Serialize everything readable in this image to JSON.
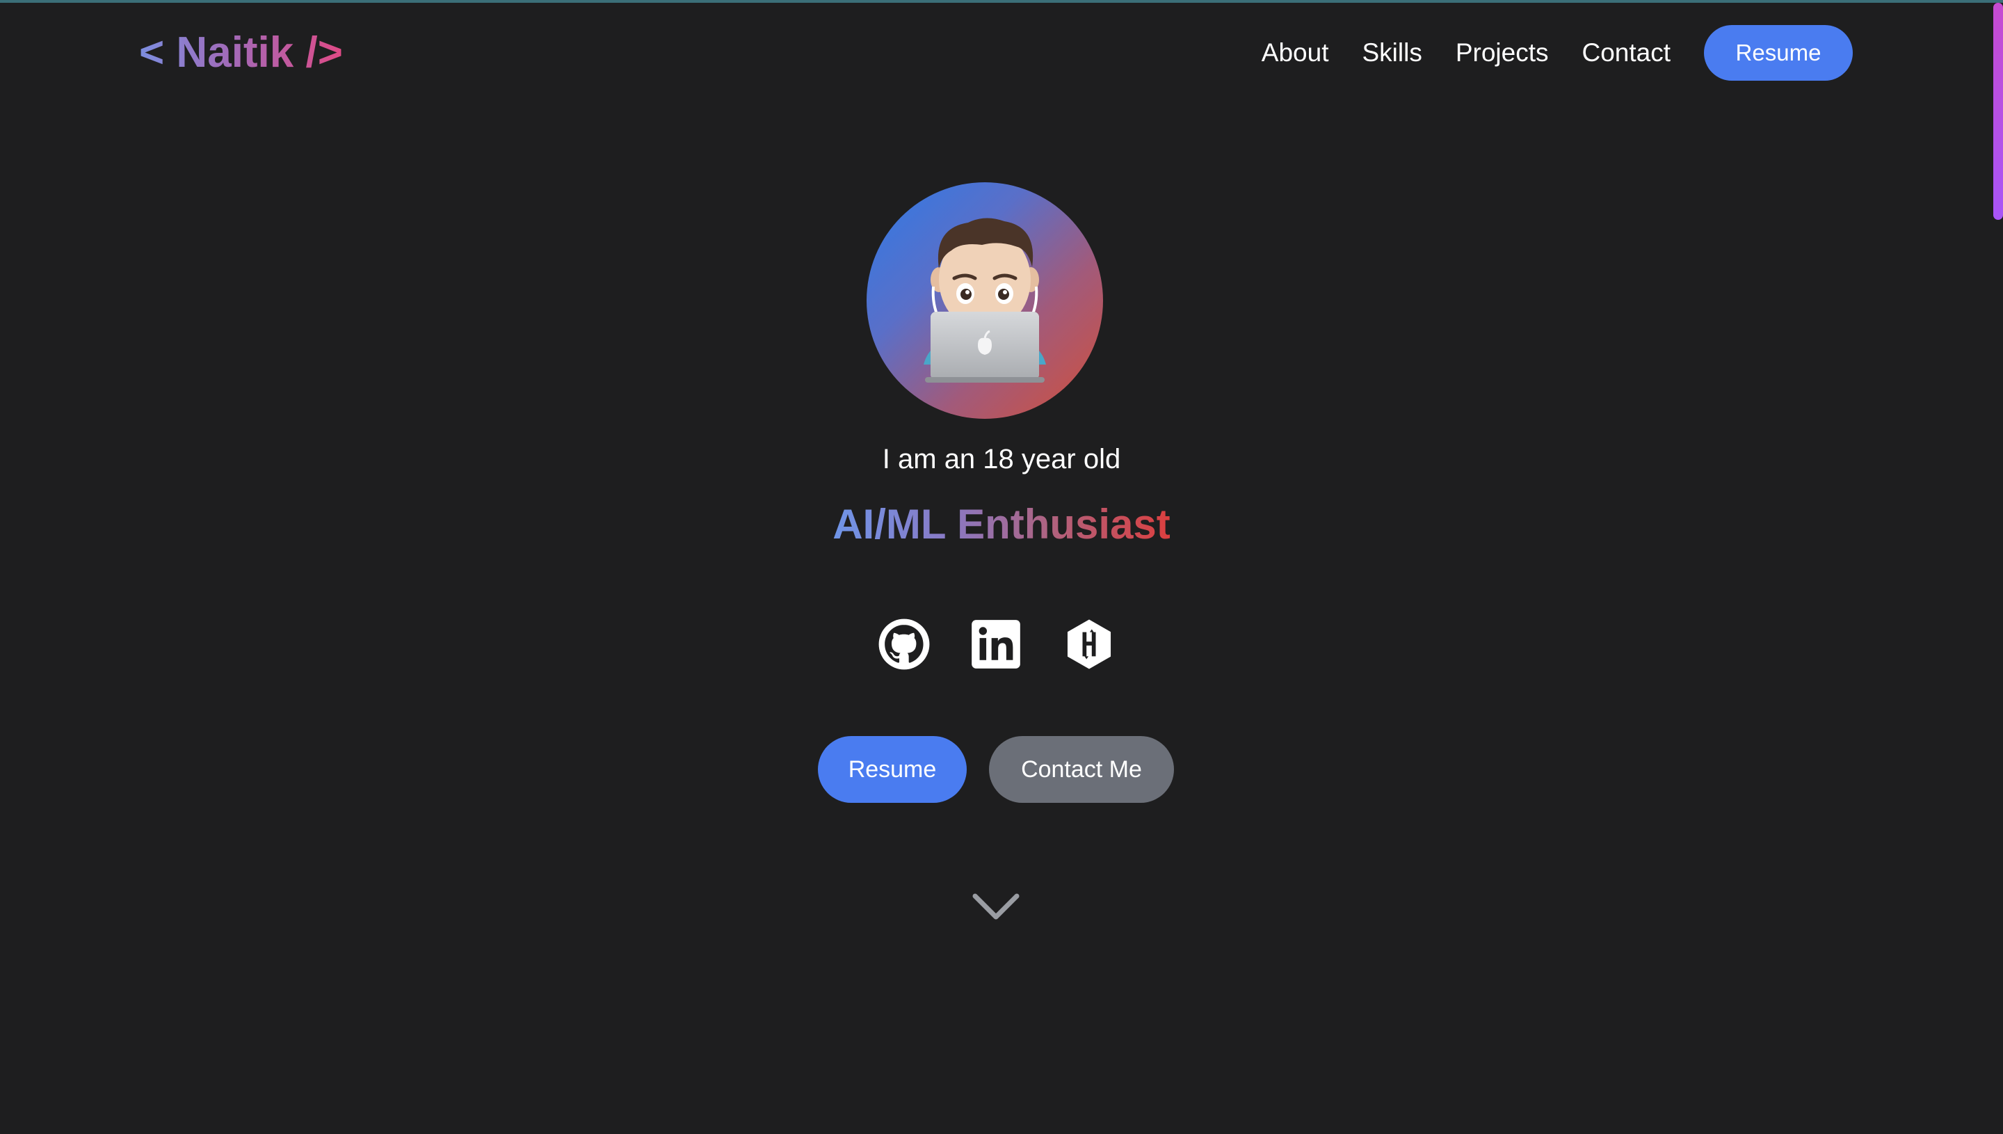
{
  "header": {
    "logo": "< Naitik />",
    "nav": {
      "about": "About",
      "skills": "Skills",
      "projects": "Projects",
      "contact": "Contact",
      "resume": "Resume"
    }
  },
  "hero": {
    "avatar_icon": "memoji-with-laptop",
    "intro": "I am an 18 year old",
    "role": "AI/ML Enthusiast",
    "social_icons": [
      "github-icon",
      "linkedin-icon",
      "hackerrank-icon"
    ],
    "buttons": {
      "resume": "Resume",
      "contact": "Contact Me"
    },
    "scroll_icon": "chevron-down-icon"
  },
  "colors": {
    "background": "#1e1e1f",
    "primary_button": "#4a7cf0",
    "secondary_button": "#6b6f78",
    "text": "#ffffff"
  }
}
